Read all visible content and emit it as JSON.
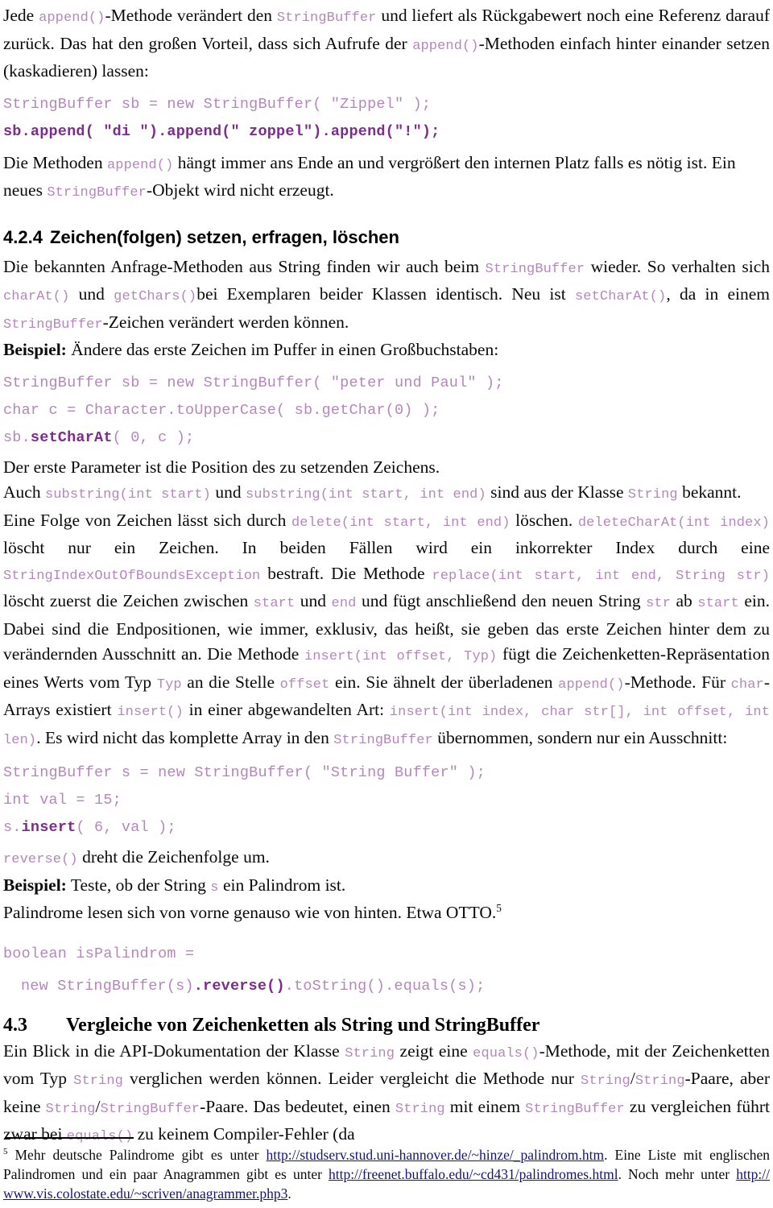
{
  "document": {
    "language": "de",
    "colors": {
      "code_regular": "#b487bb",
      "code_bold": "#7d2b8d",
      "link": "#141478",
      "text": "#0a0a0a"
    }
  },
  "paragraphs": {
    "p1": {
      "seg1": "Jede ",
      "code1": "append()",
      "seg2": "-Methode verändert den ",
      "code2": "StringBuffer",
      "seg3": " und liefert als Rückgabewert noch eine Referenz darauf zurück. Das hat den großen Vorteil, dass sich Aufrufe der ",
      "code3": "append()",
      "seg4": "-Methoden einfach hinter einander setzen (kaskadieren) lassen:"
    },
    "p2": {
      "seg1": "Die Methoden ",
      "code1": "append()",
      "seg2": " hängt immer ans Ende an und vergrößert den internen Platz falls es nötig ist. Ein neues ",
      "code2": "StringBuffer",
      "seg3": "-Objekt wird nicht erzeugt."
    },
    "p3": {
      "seg1": "Die bekannten Anfrage-Methoden aus String finden wir auch beim ",
      "code1": "StringBuffer",
      "seg2": " wieder. So verhalten sich ",
      "code2": "charAt()",
      "seg3": " und ",
      "code3": "getChars()",
      "seg4": "bei Exemplaren beider Klassen identisch. Neu ist ",
      "code4": "setCharAt()",
      "seg5": ", da in einem ",
      "code5": "StringBuffer",
      "seg6": "-Zeichen verändert werden können."
    },
    "p4": {
      "lead": "Beispiel:",
      "seg1": " Ändere das erste Zeichen im Puffer in einen Großbuchstaben:"
    },
    "p5": {
      "seg1": "Der erste Parameter ist die Position des zu setzenden Zeichens."
    },
    "p6": {
      "seg1": "Auch ",
      "code1": "substring(int start)",
      "seg2": " und ",
      "code2": "substring(int start, int end)",
      "seg3": " sind aus der Klasse ",
      "code3": "String",
      "seg4": " bekannt."
    },
    "p7": {
      "seg1": "Eine Folge von Zeichen lässt sich durch ",
      "code1": "delete(int start, int end)",
      "seg2": " löschen. ",
      "code2": "deleteCharAt(int index)",
      "seg3": " löscht nur ein Zeichen. In beiden Fällen wird ein inkorrekter Index durch eine ",
      "code3": "StringIndexOutOfBoundsException",
      "seg4": " bestraft. Die Methode ",
      "code4": "replace(int start, int end, String str)",
      "seg5": " löscht zuerst die Zeichen zwischen ",
      "code5": "start",
      "seg6": " und ",
      "code6": "end",
      "seg7": " und fügt anschließend den neuen String ",
      "code7": "str",
      "seg8": " ab ",
      "code8": "start",
      "seg9": " ein. Dabei sind die Endpositionen, wie immer, exklusiv, das heißt, sie geben das erste Zeichen hinter dem zu verändernden Ausschnitt an. Die Methode ",
      "code9": "insert(int offset, Typ)",
      "seg10": " fügt die Zeichenketten-Repräsentation eines Werts vom Typ ",
      "code10": "Typ",
      "seg11": " an die Stelle ",
      "code11": "offset",
      "seg12": " ein. Sie ähnelt der überladenen ",
      "code12": "append()",
      "seg13": "-Methode. Für ",
      "code13": "char",
      "seg14": "-Arrays existiert ",
      "code14": "insert()",
      "seg15": " in einer abgewandelten Art: ",
      "code15": "insert(int index, char str[], int offset, int len)",
      "seg16": ". Es wird nicht das komplette Array in den ",
      "code16": "StringBuffer",
      "seg17": " übernommen, sondern nur ein Ausschnitt:"
    },
    "p8": {
      "code1": "reverse()",
      "seg1": " dreht die Zeichenfolge um."
    },
    "p9": {
      "lead": "Beispiel:",
      "seg1": " Teste, ob der String ",
      "code1": "s",
      "seg2": " ein Palindrom ist."
    },
    "p10": {
      "seg1": "Palindrome lesen sich von vorne genauso wie von hinten. Etwa OTTO.",
      "footnote_marker": "5"
    },
    "p11": {
      "seg1": "Ein Blick in die API-Dokumentation der Klasse ",
      "code1": "String",
      "seg2": " zeigt eine ",
      "code2": "equals()",
      "seg3": "-Methode, mit der Zeichenketten vom Typ ",
      "code3": "String",
      "seg4": " verglichen werden können. Leider vergleicht die Methode nur ",
      "code4": "String",
      "seg5": "/",
      "code5": "String",
      "seg6": "-Paare, aber keine ",
      "code6": "String",
      "seg7": "/",
      "code7": "StringBuffer",
      "seg8": "-Paare. Das bedeutet, einen ",
      "code8": "String",
      "seg9": " mit einem ",
      "code9": "StringBuffer",
      "seg10": " zu vergleichen führt zwar bei ",
      "code10": "equals()",
      "seg11": " zu keinem Compiler-Fehler (da"
    }
  },
  "headings": {
    "h424": {
      "number": "4.2.4",
      "title": "Zeichen(folgen) setzen, erfragen, löschen"
    },
    "h43": {
      "number": "4.3",
      "title": "Vergleiche von Zeichenketten als String und StringBuffer"
    }
  },
  "code_blocks": {
    "block1": {
      "line1": "StringBuffer sb = new StringBuffer( \"Zippel\" );",
      "line2": "sb.append( \"di \").append(\" zoppel\").append(\"!\");"
    },
    "block2": {
      "line1": "StringBuffer sb = new StringBuffer( \"peter und Paul\" );",
      "line2": "char c = Character.toUpperCase( sb.getChar(0) );",
      "line3_prefix": "sb.",
      "line3_bold": "setCharAt",
      "line3_suffix": "( 0, c );"
    },
    "block3": {
      "line1": "StringBuffer s = new StringBuffer( \"String Buffer\" );",
      "line2": "int val = 15;",
      "line3_prefix": "s.",
      "line3_bold": "insert",
      "line3_suffix": "( 6, val );"
    },
    "block4": {
      "line1": "boolean isPalindrom =",
      "line2_prefix": "new StringBuffer(s)",
      "line2_bold": ".reverse()",
      "line2_suffix": ".toString().equals(s);"
    }
  },
  "footnote": {
    "marker": "5",
    "seg1": " Mehr deutsche Palindrome gibt es unter ",
    "url1": "http://studserv.stud.uni-hannover.de/~hinze/_palindrom.htm",
    "seg2": ". Eine Liste mit englischen Palindromen und ein paar Anagrammen gibt es unter ",
    "url2": "http://freenet.buffalo.edu/~cd431/palindromes.html",
    "seg3": ". Noch mehr unter ",
    "url3": "http:// www.vis.colostate.edu/~scriven/anagrammer.php3",
    "seg4": "."
  }
}
